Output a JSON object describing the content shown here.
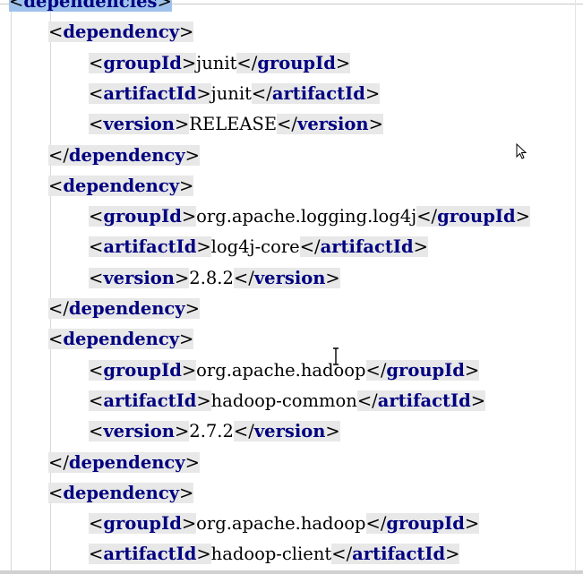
{
  "editor": {
    "lines": [
      {
        "indent": 0,
        "kind": "open",
        "tag": "dependencies",
        "selected": true
      },
      {
        "indent": 1,
        "kind": "open",
        "tag": "dependency"
      },
      {
        "indent": 2,
        "kind": "elem",
        "tag": "groupId",
        "value": "junit"
      },
      {
        "indent": 2,
        "kind": "elem",
        "tag": "artifactId",
        "value": "junit"
      },
      {
        "indent": 2,
        "kind": "elem",
        "tag": "version",
        "value": "RELEASE"
      },
      {
        "indent": 1,
        "kind": "close",
        "tag": "dependency"
      },
      {
        "indent": 1,
        "kind": "open",
        "tag": "dependency"
      },
      {
        "indent": 2,
        "kind": "elem",
        "tag": "groupId",
        "value": "org.apache.logging.log4j"
      },
      {
        "indent": 2,
        "kind": "elem",
        "tag": "artifactId",
        "value": "log4j-core"
      },
      {
        "indent": 2,
        "kind": "elem",
        "tag": "version",
        "value": "2.8.2"
      },
      {
        "indent": 1,
        "kind": "close",
        "tag": "dependency"
      },
      {
        "indent": 1,
        "kind": "open",
        "tag": "dependency"
      },
      {
        "indent": 2,
        "kind": "elem",
        "tag": "groupId",
        "value": "org.apache.hadoop"
      },
      {
        "indent": 2,
        "kind": "elem",
        "tag": "artifactId",
        "value": "hadoop-common"
      },
      {
        "indent": 2,
        "kind": "elem",
        "tag": "version",
        "value": "2.7.2"
      },
      {
        "indent": 1,
        "kind": "close",
        "tag": "dependency"
      },
      {
        "indent": 1,
        "kind": "open",
        "tag": "dependency"
      },
      {
        "indent": 2,
        "kind": "elem",
        "tag": "groupId",
        "value": "org.apache.hadoop"
      },
      {
        "indent": 2,
        "kind": "elem",
        "tag": "artifactId",
        "value": "hadoop-client"
      }
    ]
  },
  "colors": {
    "tag": "#000080",
    "text": "#000000",
    "highlight": "#e8e8e8",
    "selection": "#9fc2ec"
  },
  "icons": {
    "mouse_pointer": "arrow-cursor-icon",
    "text_cursor": "i-beam-cursor-icon"
  }
}
